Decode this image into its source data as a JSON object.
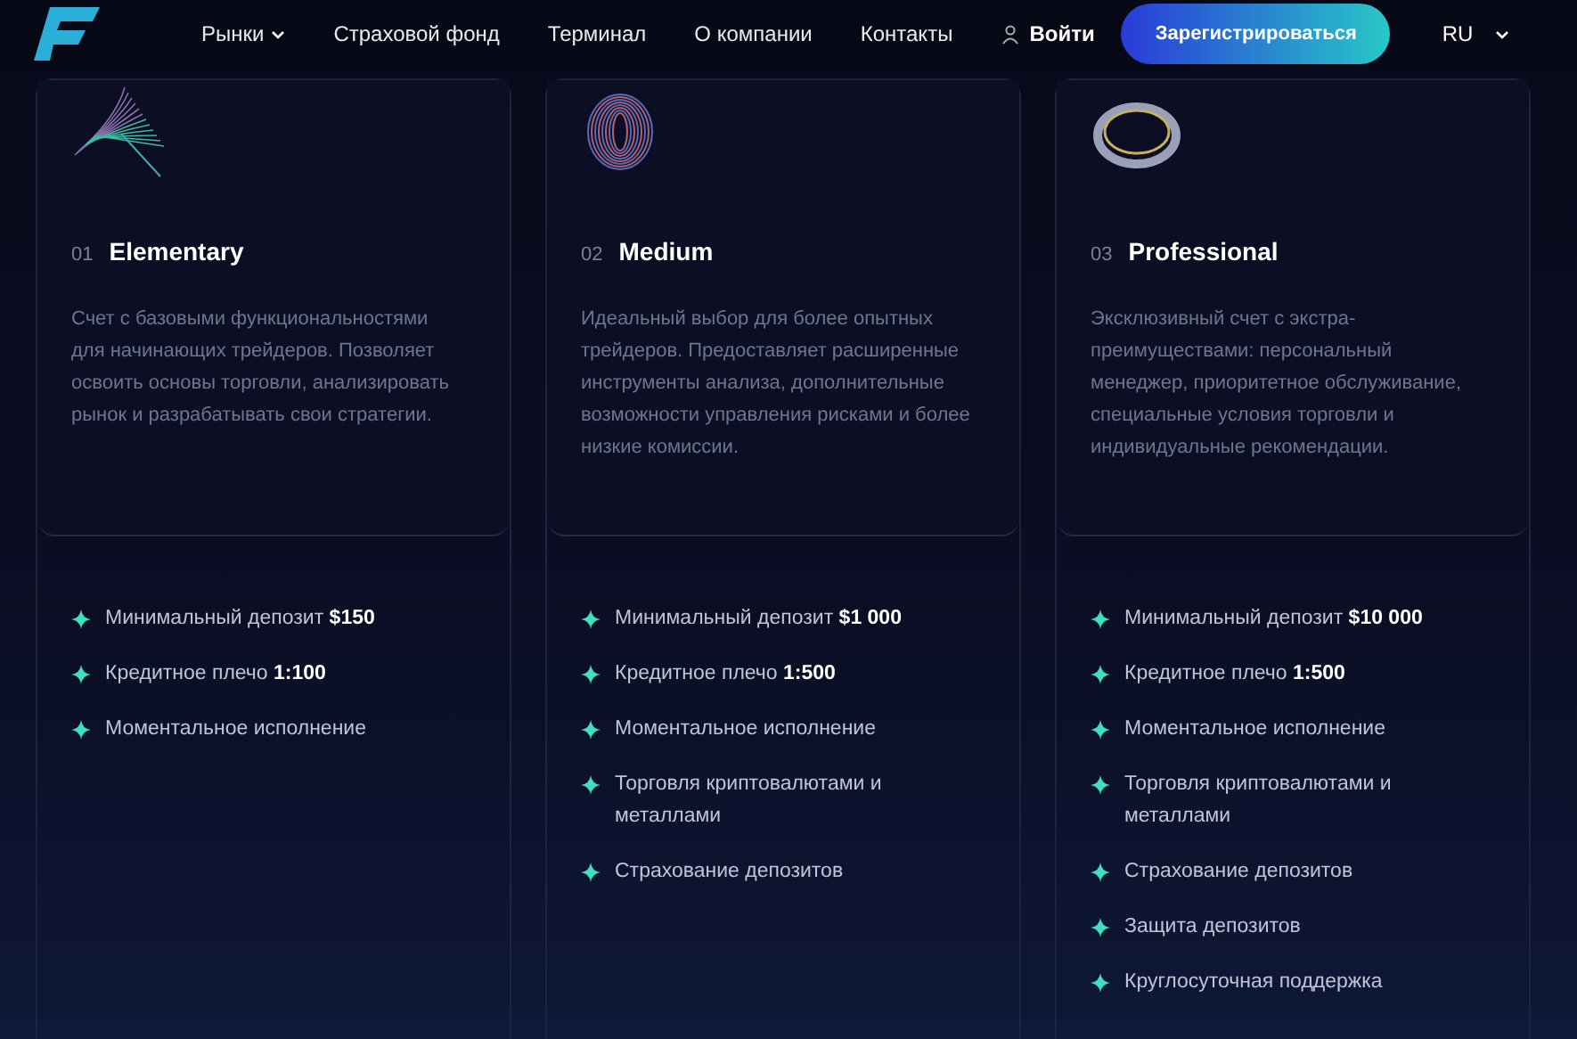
{
  "nav": {
    "items": [
      {
        "label": "Рынки",
        "has_menu": true
      },
      {
        "label": "Страховой фонд",
        "has_menu": false
      },
      {
        "label": "Терминал",
        "has_menu": false
      },
      {
        "label": "О компании",
        "has_menu": false
      },
      {
        "label": "Контакты",
        "has_menu": false
      }
    ],
    "login": "Войти",
    "register": "Зарегистрироваться",
    "language": "RU"
  },
  "plans": [
    {
      "kind": "wave",
      "number": "01",
      "name": "Elementary",
      "description": "Счет с базовыми функциональностями для начинающих трейдеров. Позволяет освоить основы торговли, анализировать рынок и разрабатывать свои стратегии.",
      "features": [
        {
          "text": "Минимальный депозит",
          "value": "$150"
        },
        {
          "text": "Кредитное плечо",
          "value": "1:100"
        },
        {
          "text": "Моментальное исполнение"
        }
      ]
    },
    {
      "kind": "shell",
      "number": "02",
      "name": "Medium",
      "description": "Идеальный выбор для более опытных трейдеров. Предоставляет расширенные инструменты анализа, дополнительные возможности управления рисками и более низкие комиссии.",
      "features": [
        {
          "text": "Минимальный депозит",
          "value": "$1 000"
        },
        {
          "text": "Кредитное плечо",
          "value": "1:500"
        },
        {
          "text": "Моментальное исполнение"
        },
        {
          "text": "Торговля криптовалютами и металлами"
        },
        {
          "text": "Страхование депозитов"
        }
      ]
    },
    {
      "kind": "ring",
      "number": "03",
      "name": "Professional",
      "description": "Эксклюзивный счет с экстра-преимуществами: персональный менеджер, приоритетное обслуживание, специальные условия торговли и индивидуальные рекомендации.",
      "features": [
        {
          "text": "Минимальный депозит",
          "value": "$10 000"
        },
        {
          "text": "Кредитное плечо",
          "value": "1:500"
        },
        {
          "text": "Моментальное исполнение"
        },
        {
          "text": "Торговля криптовалютами и металлами"
        },
        {
          "text": "Страхование депозитов"
        },
        {
          "text": "Защита депозитов"
        },
        {
          "text": "Круглосуточная поддержка"
        }
      ]
    }
  ]
}
